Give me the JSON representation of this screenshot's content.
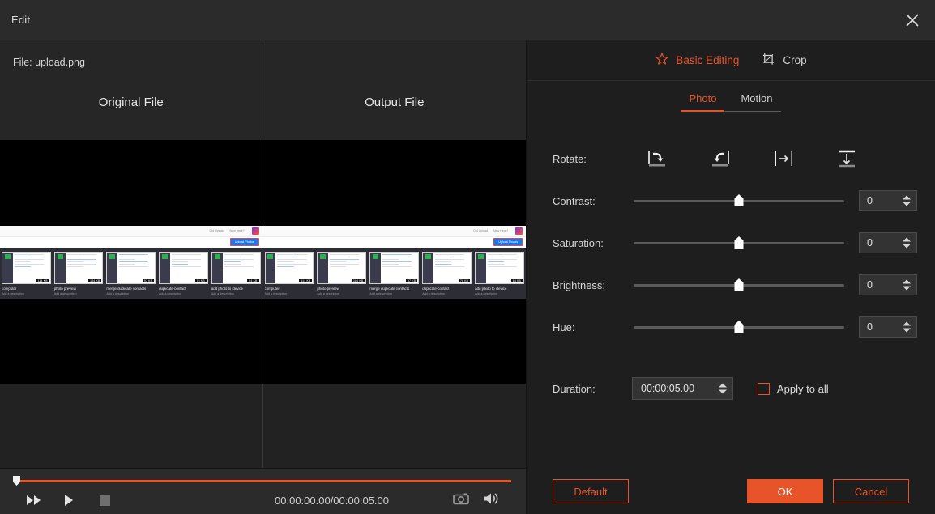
{
  "window": {
    "title": "Edit",
    "close_icon": "close-icon"
  },
  "left_panel": {
    "file_label": "File:  upload.png",
    "original_title": "Original File",
    "output_title": "Output File",
    "preview_content": {
      "topbar_links": [
        "Old Upload",
        "New Here?"
      ],
      "logo_icon": "app-logo-icon",
      "upload_button": "Upload Photos",
      "cards": [
        {
          "caption": "computer",
          "sub": "Add a description",
          "badge": "114 KB"
        },
        {
          "caption": "photo preview",
          "sub": "Add a description",
          "badge": "184 KB"
        },
        {
          "caption": "merge duplicate contacts",
          "sub": "Add a description",
          "badge": "97 KB"
        },
        {
          "caption": "duplicate-contact",
          "sub": "Add a description",
          "badge": "76 KB"
        },
        {
          "caption": "add photo to idevice",
          "sub": "Add a description",
          "badge": "64 KB"
        }
      ]
    }
  },
  "transport": {
    "fast_forward_icon": "fast-forward-icon",
    "play_icon": "play-icon",
    "stop_icon": "stop-icon",
    "timecode": "00:00:00.00/00:00:05.00",
    "snapshot_icon": "camera-icon",
    "volume_icon": "volume-icon",
    "progress_percent": 0
  },
  "right_panel": {
    "mode_tabs": [
      {
        "label": "Basic Editing",
        "icon": "magic-wand-star-icon",
        "active": true
      },
      {
        "label": "Crop",
        "icon": "crop-icon",
        "active": false
      }
    ],
    "sub_tabs": [
      {
        "label": "Photo",
        "active": true
      },
      {
        "label": "Motion",
        "active": false
      }
    ],
    "rotate": {
      "label": "Rotate:",
      "buttons": [
        {
          "icon": "rotate-right-icon"
        },
        {
          "icon": "rotate-left-icon"
        },
        {
          "icon": "flip-horizontal-icon"
        },
        {
          "icon": "flip-vertical-icon"
        }
      ]
    },
    "sliders": [
      {
        "label": "Contrast:",
        "value": "0",
        "percent": 50
      },
      {
        "label": "Saturation:",
        "value": "0",
        "percent": 50
      },
      {
        "label": "Brightness:",
        "value": "0",
        "percent": 50
      },
      {
        "label": "Hue:",
        "value": "0",
        "percent": 50
      }
    ],
    "duration": {
      "label": "Duration:",
      "value": "00:00:05.00",
      "apply_to_all_label": "Apply to all",
      "apply_to_all_checked": false
    },
    "buttons": {
      "default_label": "Default",
      "ok_label": "OK",
      "cancel_label": "Cancel"
    }
  },
  "colors": {
    "accent": "#e8542a",
    "window_bg": "#1e1e1e",
    "titlebar_bg": "#2b2b2b",
    "preview_bg": "#000000"
  }
}
